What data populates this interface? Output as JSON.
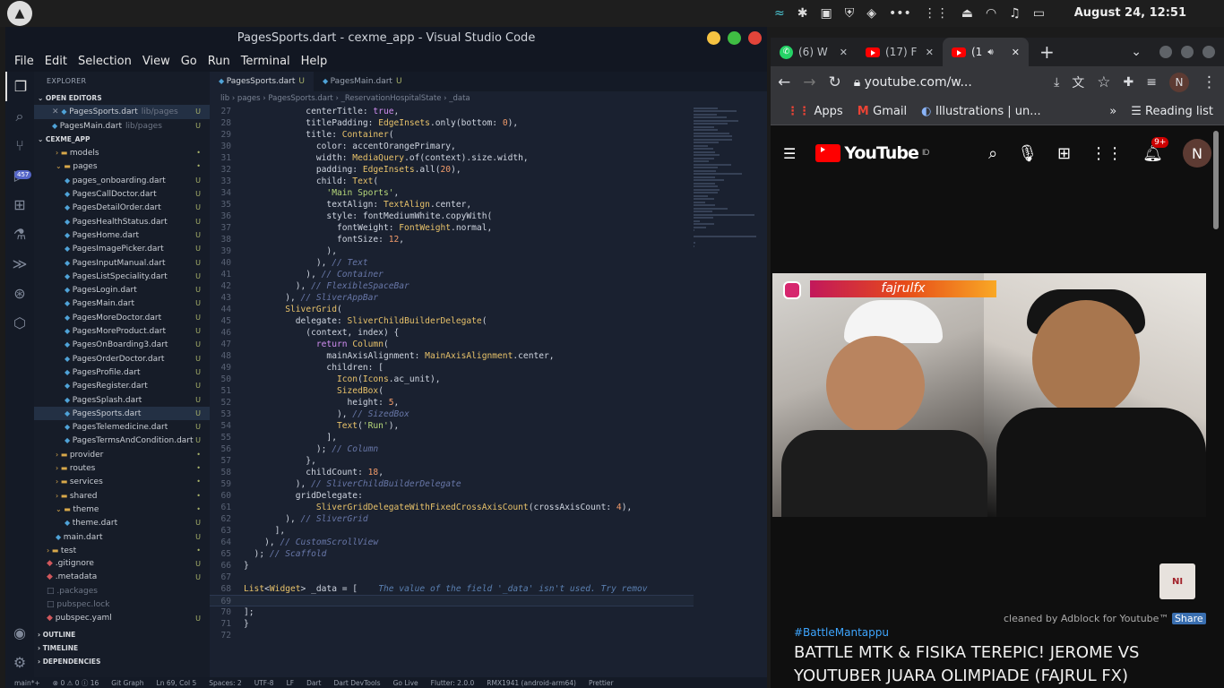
{
  "system": {
    "clock": "August 24, 12:51"
  },
  "vscode": {
    "title": "PagesSports.dart - cexme_app - Visual Studio Code",
    "menu": [
      "File",
      "Edit",
      "Selection",
      "View",
      "Go",
      "Run",
      "Terminal",
      "Help"
    ],
    "activity_badge": "457",
    "explorer_label": "EXPLORER",
    "open_editors_label": "OPEN EDITORS",
    "open_editors": [
      {
        "name": "PagesSports.dart",
        "path": "lib/pages",
        "status": "U"
      },
      {
        "name": "PagesMain.dart",
        "path": "lib/pages",
        "status": "U"
      }
    ],
    "project_label": "CEXME_APP",
    "tree": [
      {
        "name": "models",
        "type": "folder",
        "indent": 1,
        "status": "•"
      },
      {
        "name": "pages",
        "type": "folder-open",
        "indent": 1,
        "status": "•"
      },
      {
        "name": "pages_onboarding.dart",
        "type": "dart",
        "indent": 2,
        "status": "U"
      },
      {
        "name": "PagesCallDoctor.dart",
        "type": "dart",
        "indent": 2,
        "status": "U"
      },
      {
        "name": "PagesDetailOrder.dart",
        "type": "dart",
        "indent": 2,
        "status": "U"
      },
      {
        "name": "PagesHealthStatus.dart",
        "type": "dart",
        "indent": 2,
        "status": "U"
      },
      {
        "name": "PagesHome.dart",
        "type": "dart",
        "indent": 2,
        "status": "U"
      },
      {
        "name": "PagesImagePicker.dart",
        "type": "dart",
        "indent": 2,
        "status": "U"
      },
      {
        "name": "PagesInputManual.dart",
        "type": "dart",
        "indent": 2,
        "status": "U"
      },
      {
        "name": "PagesListSpeciality.dart",
        "type": "dart",
        "indent": 2,
        "status": "U"
      },
      {
        "name": "PagesLogin.dart",
        "type": "dart",
        "indent": 2,
        "status": "U"
      },
      {
        "name": "PagesMain.dart",
        "type": "dart",
        "indent": 2,
        "status": "U"
      },
      {
        "name": "PagesMoreDoctor.dart",
        "type": "dart",
        "indent": 2,
        "status": "U"
      },
      {
        "name": "PagesMoreProduct.dart",
        "type": "dart",
        "indent": 2,
        "status": "U"
      },
      {
        "name": "PagesOnBoarding3.dart",
        "type": "dart",
        "indent": 2,
        "status": "U"
      },
      {
        "name": "PagesOrderDoctor.dart",
        "type": "dart",
        "indent": 2,
        "status": "U"
      },
      {
        "name": "PagesProfile.dart",
        "type": "dart",
        "indent": 2,
        "status": "U"
      },
      {
        "name": "PagesRegister.dart",
        "type": "dart",
        "indent": 2,
        "status": "U"
      },
      {
        "name": "PagesSplash.dart",
        "type": "dart",
        "indent": 2,
        "status": "U"
      },
      {
        "name": "PagesSports.dart",
        "type": "dart",
        "indent": 2,
        "status": "U",
        "selected": true
      },
      {
        "name": "PagesTelemedicine.dart",
        "type": "dart",
        "indent": 2,
        "status": "U"
      },
      {
        "name": "PagesTermsAndCondition.dart",
        "type": "dart",
        "indent": 2,
        "status": "U"
      },
      {
        "name": "provider",
        "type": "folder",
        "indent": 1,
        "status": "•"
      },
      {
        "name": "routes",
        "type": "folder",
        "indent": 1,
        "status": "•"
      },
      {
        "name": "services",
        "type": "folder",
        "indent": 1,
        "status": "•"
      },
      {
        "name": "shared",
        "type": "folder",
        "indent": 1,
        "status": "•"
      },
      {
        "name": "theme",
        "type": "folder-open",
        "indent": 1,
        "status": "•"
      },
      {
        "name": "theme.dart",
        "type": "dart",
        "indent": 2,
        "status": "U"
      },
      {
        "name": "main.dart",
        "type": "dart",
        "indent": 1,
        "status": "U"
      },
      {
        "name": "test",
        "type": "folder",
        "indent": 0,
        "status": "•"
      },
      {
        "name": ".gitignore",
        "type": "file",
        "indent": 0,
        "status": "U"
      },
      {
        "name": ".metadata",
        "type": "file",
        "indent": 0,
        "status": "U"
      },
      {
        "name": ".packages",
        "type": "dim",
        "indent": 0,
        "status": ""
      },
      {
        "name": "pubspec.lock",
        "type": "dim",
        "indent": 0,
        "status": ""
      },
      {
        "name": "pubspec.yaml",
        "type": "file",
        "indent": 0,
        "status": "U"
      }
    ],
    "outline_label": "OUTLINE",
    "timeline_label": "TIMELINE",
    "dependencies_label": "DEPENDENCIES",
    "tabs": [
      {
        "label": "PagesSports.dart",
        "status": "U",
        "active": true
      },
      {
        "label": "PagesMain.dart",
        "status": "U",
        "active": false
      }
    ],
    "breadcrumb": "lib › pages › PagesSports.dart › _ReservationHospitalState › _data",
    "code": [
      {
        "n": "27",
        "t": "            centerTitle: true,"
      },
      {
        "n": "28",
        "t": "            titlePadding: EdgeInsets.only(bottom: 0),"
      },
      {
        "n": "29",
        "t": "            title: Container("
      },
      {
        "n": "30",
        "t": "              color: accentOrangePrimary,"
      },
      {
        "n": "31",
        "t": "              width: MediaQuery.of(context).size.width,"
      },
      {
        "n": "32",
        "t": "              padding: EdgeInsets.all(20),"
      },
      {
        "n": "33",
        "t": "              child: Text("
      },
      {
        "n": "34",
        "t": "                'Main Sports',"
      },
      {
        "n": "35",
        "t": "                textAlign: TextAlign.center,"
      },
      {
        "n": "36",
        "t": "                style: fontMediumWhite.copyWith("
      },
      {
        "n": "37",
        "t": "                  fontWeight: FontWeight.normal,"
      },
      {
        "n": "38",
        "t": "                  fontSize: 12,"
      },
      {
        "n": "39",
        "t": "                ),"
      },
      {
        "n": "40",
        "t": "              ), // Text"
      },
      {
        "n": "41",
        "t": "            ), // Container"
      },
      {
        "n": "42",
        "t": "          ), // FlexibleSpaceBar"
      },
      {
        "n": "43",
        "t": "        ), // SliverAppBar"
      },
      {
        "n": "44",
        "t": "        SliverGrid("
      },
      {
        "n": "45",
        "t": "          delegate: SliverChildBuilderDelegate("
      },
      {
        "n": "46",
        "t": "            (context, index) {"
      },
      {
        "n": "47",
        "t": "              return Column("
      },
      {
        "n": "48",
        "t": "                mainAxisAlignment: MainAxisAlignment.center,"
      },
      {
        "n": "49",
        "t": "                children: ["
      },
      {
        "n": "50",
        "t": "                  Icon(Icons.ac_unit),"
      },
      {
        "n": "51",
        "t": "                  SizedBox("
      },
      {
        "n": "52",
        "t": "                    height: 5,"
      },
      {
        "n": "53",
        "t": "                  ), // SizedBox"
      },
      {
        "n": "54",
        "t": "                  Text('Run'),"
      },
      {
        "n": "55",
        "t": "                ],"
      },
      {
        "n": "56",
        "t": "              ); // Column"
      },
      {
        "n": "57",
        "t": "            },"
      },
      {
        "n": "58",
        "t": "            childCount: 18,"
      },
      {
        "n": "59",
        "t": "          ), // SliverChildBuilderDelegate"
      },
      {
        "n": "60",
        "t": "          gridDelegate:"
      },
      {
        "n": "61",
        "t": "              SliverGridDelegateWithFixedCrossAxisCount(crossAxisCount: 4),"
      },
      {
        "n": "62",
        "t": "        ), // SliverGrid"
      },
      {
        "n": "63",
        "t": "      ],"
      },
      {
        "n": "64",
        "t": "    ), // CustomScrollView"
      },
      {
        "n": "65",
        "t": "  ); // Scaffold"
      },
      {
        "n": "66",
        "t": "}"
      },
      {
        "n": "67",
        "t": ""
      },
      {
        "n": "68",
        "t": "List<Widget> _data = [    The value of the field '_data' isn't used. Try remov"
      },
      {
        "n": "69",
        "t": "",
        "cur": true
      },
      {
        "n": "70",
        "t": "];"
      },
      {
        "n": "71",
        "t": "}"
      },
      {
        "n": "72",
        "t": ""
      }
    ],
    "status": [
      "main*+",
      "⊗ 0 ⚠ 0 ⓘ 16",
      "Git Graph",
      "Ln 69, Col 5",
      "Spaces: 2",
      "UTF-8",
      "LF",
      "Dart",
      "Dart DevTools",
      "Go Live",
      "Flutter: 2.0.0",
      "RMX1941 (android-arm64)",
      "Prettier"
    ]
  },
  "chrome": {
    "tabs": [
      {
        "label": "(6) W",
        "icon": "whatsapp-icon"
      },
      {
        "label": "(17) F",
        "icon": "youtube-icon"
      },
      {
        "label": "(1",
        "icon": "youtube-icon",
        "active": true
      }
    ],
    "url": "youtube.com/w...",
    "profile": "N",
    "bookmarks": [
      "Apps",
      "Gmail",
      "Illustrations | un..."
    ],
    "reading_list": "Reading list",
    "yt": {
      "logo": "YouTube",
      "region": "ID",
      "notif_badge": "9+",
      "avatar": "N",
      "ig_name": "fajrulfx",
      "adblock_text": "cleaned by Adblock for Youtube™",
      "share": "Share",
      "hashtag": "#BattleMantappu",
      "video_title": "BATTLE MTK & FISIKA TEREPIC! JEROME VS YOUTUBER JUARA OLIMPIADE (FAJRUL FX)"
    }
  }
}
